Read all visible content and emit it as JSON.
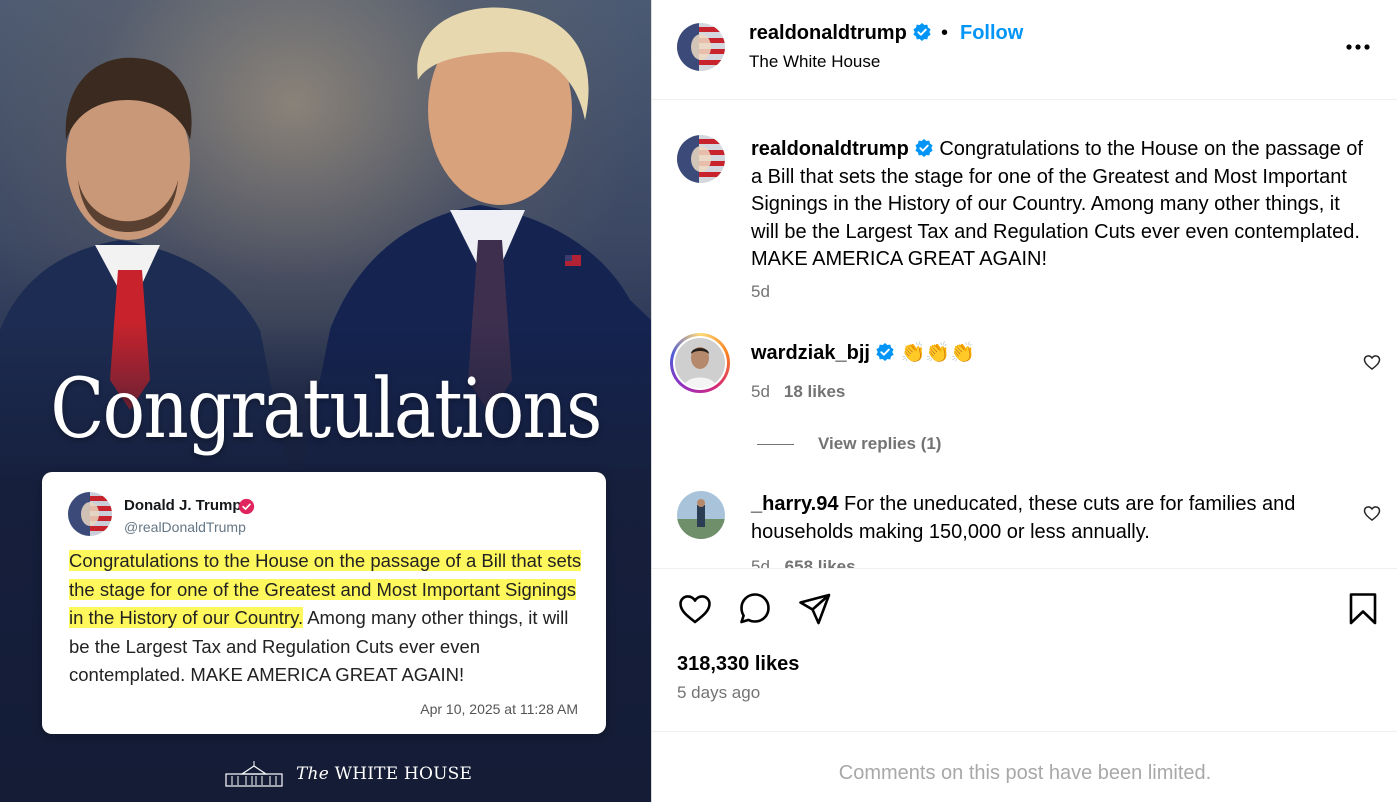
{
  "image": {
    "headline": "Congratulations",
    "tweet": {
      "name": "Donald J. Trump",
      "handle": "@realDonaldTrump",
      "highlighted_text": "Congratulations to the House on the passage of a Bill that sets the stage for one of the Greatest and Most Important Signings in the History of our Country.",
      "rest_text": " Among many other things, it will be the Largest Tax and Regulation Cuts ever even contemplated. MAKE AMERICA GREAT AGAIN!",
      "date": "Apr 10, 2025 at 11:28 AM"
    },
    "footer_prefix": "The",
    "footer_name": "WHITE HOUSE"
  },
  "header": {
    "username": "realdonaldtrump",
    "dot": "•",
    "follow_label": "Follow",
    "subtitle": "The White House"
  },
  "caption": {
    "username": "realdonaldtrump",
    "text": "Congratulations to the House on the passage of a Bill that sets the stage for one of the Greatest and Most Important Signings in the History of our Country. Among many other things, it will be the Largest Tax and Regulation Cuts ever even contemplated. MAKE AMERICA GREAT AGAIN!",
    "time": "5d"
  },
  "comments": [
    {
      "username": "wardziak_bjj",
      "text": "👏👏👏",
      "time": "5d",
      "likes": "18 likes",
      "view_replies": "View replies (1)"
    },
    {
      "username": "_harry.94",
      "text": "For the uneducated, these cuts are for families and households making 150,000 or less annually.",
      "time": "5d",
      "likes": "658 likes"
    }
  ],
  "stats": {
    "likes": "318,330 likes",
    "ago": "5 days ago"
  },
  "footer": {
    "limited": "Comments on this post have been limited."
  },
  "colors": {
    "link": "#0095f6",
    "verified": "#0095f6",
    "secondary": "#737373",
    "highlight": "#fff85c"
  },
  "icons": [
    "more-icon",
    "verified-icon",
    "heart-icon",
    "comment-icon",
    "share-icon",
    "bookmark-icon"
  ]
}
